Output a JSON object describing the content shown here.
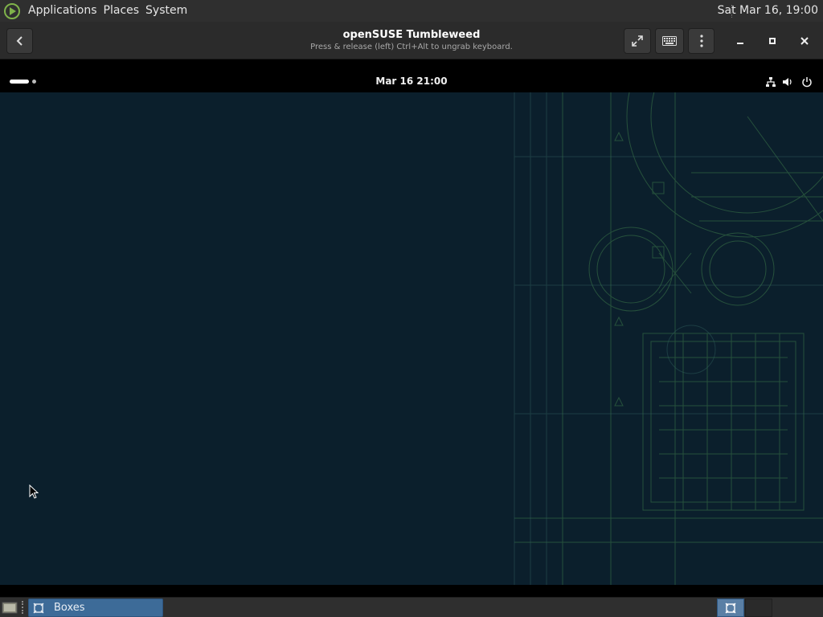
{
  "top_panel": {
    "menu": [
      "Applications",
      "Places",
      "System"
    ],
    "clock": "Sat Mar 16, 19:00"
  },
  "header_bar": {
    "title": "openSUSE Tumbleweed",
    "subtitle": "Press & release (left) Ctrl+Alt to ungrab keyboard.",
    "buttons": [
      "back-icon",
      "fullscreen-icon",
      "keyboard-icon",
      "menu-icon",
      "minimize-icon",
      "maximize-icon",
      "close-icon"
    ]
  },
  "guest": {
    "clock": "Mar 16  21:00",
    "tray_icons": [
      "network-icon",
      "volume-icon",
      "power-icon"
    ],
    "wallpaper_color": "#0b1f2c",
    "accent": "#6fbf4a"
  },
  "taskbar": {
    "task_label": "Boxes"
  }
}
